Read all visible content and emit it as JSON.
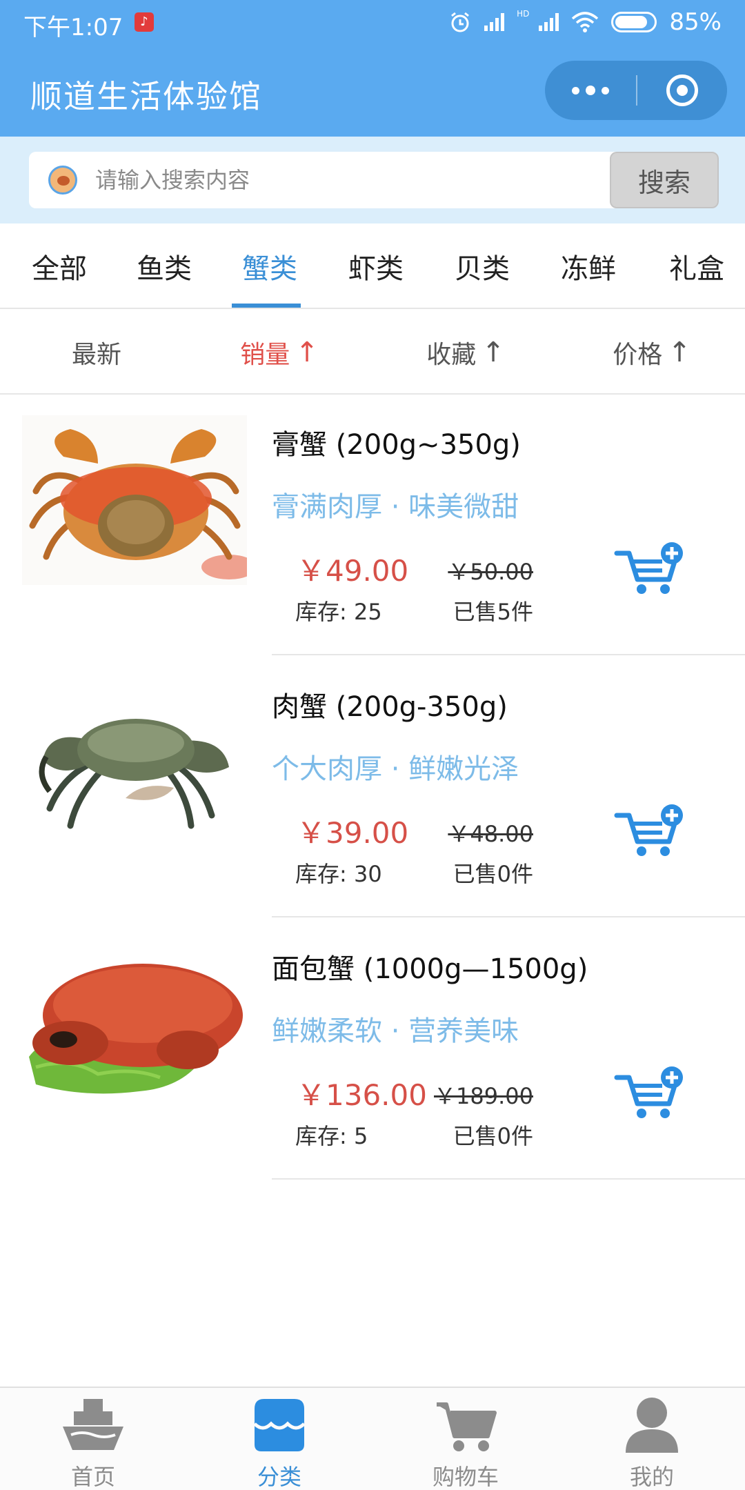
{
  "status_bar": {
    "time": "下午1:07",
    "network_badge": "HD",
    "battery": "85%",
    "battery_level": 0.85
  },
  "app": {
    "title": "顺道生活体验馆"
  },
  "search": {
    "placeholder": "请输入搜索内容",
    "button_label": "搜索"
  },
  "category_tabs": {
    "active_index": 2,
    "items": [
      {
        "label": "全部"
      },
      {
        "label": "鱼类"
      },
      {
        "label": "蟹类"
      },
      {
        "label": "虾类"
      },
      {
        "label": "贝类"
      },
      {
        "label": "冻鲜"
      },
      {
        "label": "礼盒"
      }
    ]
  },
  "sort_bar": {
    "active_index": 1,
    "items": [
      {
        "label": "最新",
        "arrow": ""
      },
      {
        "label": "销量",
        "arrow": "↑"
      },
      {
        "label": "收藏",
        "arrow": "↑"
      },
      {
        "label": "价格",
        "arrow": "↑"
      }
    ]
  },
  "products": [
    {
      "name": "膏蟹 (200g~350g)",
      "tags": "膏满肉厚 · 味美微甜",
      "price": "￥49.00",
      "original_price": "￥50.00",
      "stock": "库存: 25",
      "sold": "已售5件",
      "image_icon": "swimmer-crab-photo"
    },
    {
      "name": "肉蟹 (200g-350g)",
      "tags": "个大肉厚 · 鲜嫩光泽",
      "price": "￥39.00",
      "original_price": "￥48.00",
      "stock": "库存: 30",
      "sold": "已售0件",
      "image_icon": "mud-crab-photo"
    },
    {
      "name": "面包蟹 (1000g—1500g)",
      "tags": "鲜嫩柔软 · 营养美味",
      "price": "￥136.00",
      "original_price": "￥189.00",
      "stock": "库存: 5",
      "sold": "已售0件",
      "image_icon": "brown-crab-photo"
    }
  ],
  "bottom_nav": {
    "active_index": 1,
    "items": [
      {
        "label": "首页",
        "icon": "ship-icon"
      },
      {
        "label": "分类",
        "icon": "category-store-icon"
      },
      {
        "label": "购物车",
        "icon": "cart-icon"
      },
      {
        "label": "我的",
        "icon": "user-icon"
      }
    ]
  },
  "colors": {
    "header_bg": "#5aaaf0",
    "accent": "#3a8fd6",
    "price_red": "#d65048",
    "tag_blue": "#7dbbe8",
    "search_bg": "#dbeefb"
  }
}
